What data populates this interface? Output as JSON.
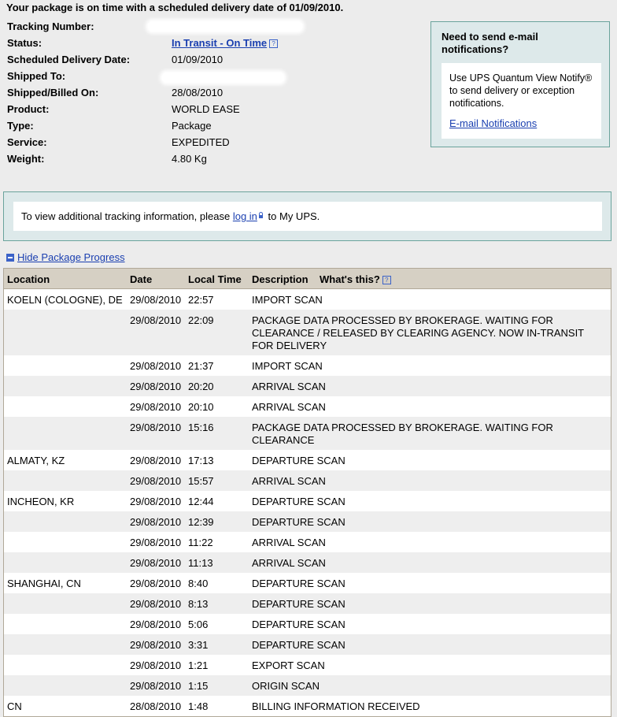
{
  "headline": "Your package is on time with a scheduled delivery date of 01/09/2010.",
  "summary": [
    {
      "label": "Tracking Number:",
      "value": "",
      "redacted": true
    },
    {
      "label": "Status:",
      "value": "In Transit - On Time",
      "link": true
    },
    {
      "label": "Scheduled Delivery Date:",
      "value": "01/09/2010"
    },
    {
      "label": "Shipped To:",
      "value": "",
      "redacted": true
    },
    {
      "label": "Shipped/Billed On:",
      "value": "28/08/2010"
    },
    {
      "label": "Product:",
      "value": "WORLD EASE"
    },
    {
      "label": "Type:",
      "value": "Package"
    },
    {
      "label": "Service:",
      "value": "EXPEDITED"
    },
    {
      "label": "Weight:",
      "value": "4.80 Kg"
    }
  ],
  "notify": {
    "title": "Need to send e-mail notifications?",
    "text": "Use UPS Quantum View Notify® to send delivery or exception notifications.",
    "link": "E-mail Notifications"
  },
  "login": {
    "before": "To view additional tracking information, please",
    "link": "log in",
    "after": "to My UPS."
  },
  "progress_toggle": "Hide Package Progress",
  "table": {
    "headers": {
      "location": "Location",
      "date": "Date",
      "time": "Local Time",
      "description": "Description",
      "whats_this": "What's this?"
    },
    "rows": [
      {
        "location": "KOELN (COLOGNE), DE",
        "date": "29/08/2010",
        "time": "22:57",
        "description": "IMPORT SCAN"
      },
      {
        "location": "",
        "date": "29/08/2010",
        "time": "22:09",
        "description": "PACKAGE DATA PROCESSED BY BROKERAGE. WAITING FOR CLEARANCE / RELEASED BY CLEARING AGENCY. NOW IN-TRANSIT FOR DELIVERY"
      },
      {
        "location": "",
        "date": "29/08/2010",
        "time": "21:37",
        "description": "IMPORT SCAN"
      },
      {
        "location": "",
        "date": "29/08/2010",
        "time": "20:20",
        "description": "ARRIVAL SCAN"
      },
      {
        "location": "",
        "date": "29/08/2010",
        "time": "20:10",
        "description": "ARRIVAL SCAN"
      },
      {
        "location": "",
        "date": "29/08/2010",
        "time": "15:16",
        "description": "PACKAGE DATA PROCESSED BY BROKERAGE. WAITING FOR CLEARANCE"
      },
      {
        "location": "ALMATY, KZ",
        "date": "29/08/2010",
        "time": "17:13",
        "description": "DEPARTURE SCAN"
      },
      {
        "location": "",
        "date": "29/08/2010",
        "time": "15:57",
        "description": "ARRIVAL SCAN"
      },
      {
        "location": "INCHEON, KR",
        "date": "29/08/2010",
        "time": "12:44",
        "description": "DEPARTURE SCAN"
      },
      {
        "location": "",
        "date": "29/08/2010",
        "time": "12:39",
        "description": "DEPARTURE SCAN"
      },
      {
        "location": "",
        "date": "29/08/2010",
        "time": "11:22",
        "description": "ARRIVAL SCAN"
      },
      {
        "location": "",
        "date": "29/08/2010",
        "time": "11:13",
        "description": "ARRIVAL SCAN"
      },
      {
        "location": "SHANGHAI, CN",
        "date": "29/08/2010",
        "time": "8:40",
        "description": "DEPARTURE SCAN"
      },
      {
        "location": "",
        "date": "29/08/2010",
        "time": "8:13",
        "description": "DEPARTURE SCAN"
      },
      {
        "location": "",
        "date": "29/08/2010",
        "time": "5:06",
        "description": "DEPARTURE SCAN"
      },
      {
        "location": "",
        "date": "29/08/2010",
        "time": "3:31",
        "description": "DEPARTURE SCAN"
      },
      {
        "location": "",
        "date": "29/08/2010",
        "time": "1:21",
        "description": "EXPORT SCAN"
      },
      {
        "location": "",
        "date": "29/08/2010",
        "time": "1:15",
        "description": "ORIGIN SCAN"
      },
      {
        "location": "CN",
        "date": "28/08/2010",
        "time": "1:48",
        "description": "BILLING INFORMATION RECEIVED"
      }
    ]
  }
}
